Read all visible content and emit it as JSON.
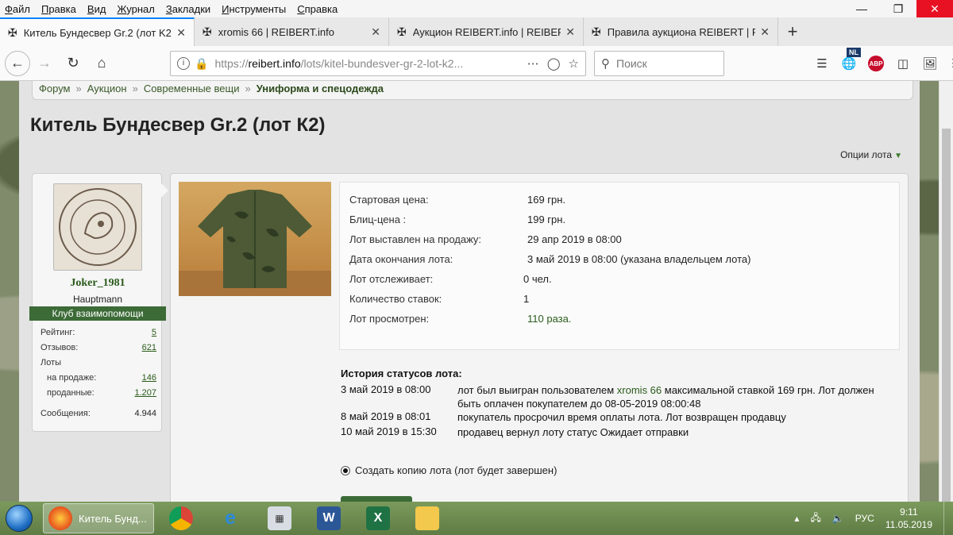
{
  "menu": [
    {
      "label": "Файл",
      "u": "Ф",
      "rest": "айл"
    },
    {
      "label": "Правка",
      "u": "П",
      "rest": "равка"
    },
    {
      "label": "Вид",
      "u": "В",
      "rest": "ид"
    },
    {
      "label": "Журнал",
      "u": "Ж",
      "rest": "урнал"
    },
    {
      "label": "Закладки",
      "u": "З",
      "rest": "акладки"
    },
    {
      "label": "Инструменты",
      "u": "И",
      "rest": "нструменты"
    },
    {
      "label": "Справка",
      "u": "С",
      "rest": "правка"
    }
  ],
  "tabs": [
    {
      "title": "Китель Бундесвер Gr.2 (лот K2)",
      "active": true
    },
    {
      "title": "xromis 66 | REIBERT.info",
      "active": false
    },
    {
      "title": "Аукцион REIBERT.info | REIBERT",
      "active": false
    },
    {
      "title": "Правила аукциона REIBERT | R",
      "active": false
    }
  ],
  "url": {
    "prefix": "https://",
    "host": "reibert.info",
    "path": "/lots/kitel-bundesver-gr-2-lot-k2..."
  },
  "search": {
    "placeholder": "Поиск"
  },
  "toolbar": {
    "nl_badge": "NL",
    "abp_label": "ABP"
  },
  "breadcrumb": {
    "items": [
      "Форум",
      "Аукцион",
      "Современные вещи"
    ],
    "current": "Униформа и спецодежда"
  },
  "page": {
    "title": "Китель Бундесвер Gr.2 (лот К2)",
    "lot_options": "Опции лота"
  },
  "user": {
    "name": "Joker_1981",
    "rank": "Hauptmann",
    "club": "Клуб взаимопомощи",
    "stats": {
      "rating_label": "Рейтинг:",
      "rating": "5",
      "reviews_label": "Отзывов:",
      "reviews": "621",
      "lots_label": "Лоты",
      "on_sale_label": "на продаже:",
      "on_sale": "146",
      "sold_label": "проданные:",
      "sold": "1.207",
      "messages_label": "Сообщения:",
      "messages": "4.944"
    },
    "avatar_text": {
      "top": "WWW.REIBERT.INFO",
      "bottom": "JOKER 1981"
    }
  },
  "lot": {
    "rows": [
      {
        "k": "Стартовая цена:",
        "v": "169 грн."
      },
      {
        "k": "Блиц-цена :",
        "v": "199 грн."
      },
      {
        "k": "Лот выставлен на продажу:",
        "v": "29 апр 2019 в 08:00"
      },
      {
        "k": "Дата окончания лота:",
        "v": "3 май 2019 в 08:00 (указана владельцем лота)"
      },
      {
        "k": "Лот отслеживает:",
        "v": "0 чел."
      },
      {
        "k": "Количество ставок:",
        "v": "1"
      },
      {
        "k": "Лот просмотрен:",
        "v": "110 раза."
      }
    ],
    "history_title": "История статусов лота:",
    "history": [
      {
        "date": "3 май 2019 в 08:00",
        "pre": "лот был выигран пользователем ",
        "link": "xromis 66",
        "post": " максимальной ставкой 169 грн. Лот должен быть оплачен покупателем до 08-05-2019 08:00:48"
      },
      {
        "date": "8 май 2019 в 08:01",
        "pre": "покупатель просрочил время оплаты лота. Лот возвращен продавцу",
        "link": "",
        "post": ""
      },
      {
        "date": "10 май 2019 в 15:30",
        "pre": "продавец вернул лоту статус Ожидает отправки",
        "link": "",
        "post": ""
      }
    ],
    "copy_option": "Создать копию лота (лот будет завершен)"
  },
  "taskbar": {
    "active_window": "Китель Бунд...",
    "lang": "РУС",
    "time": "9:11",
    "date": "11.05.2019"
  }
}
